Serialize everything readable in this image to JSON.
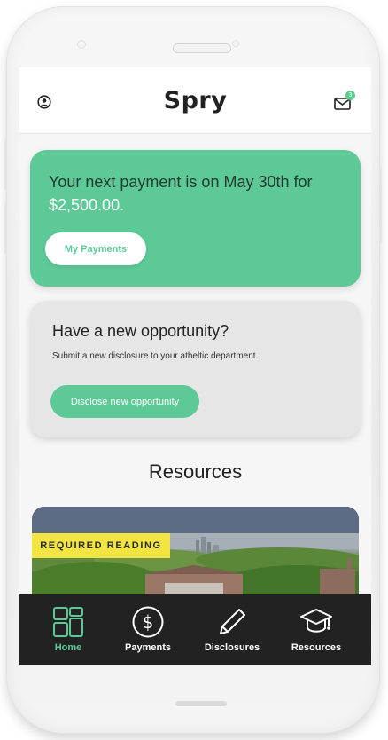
{
  "app": {
    "logo": "Spry",
    "mail_badge": "3"
  },
  "payment_card": {
    "text_prefix": "Your next payment is on May 30th for ",
    "amount": "$2,500.00.",
    "button_label": "My Payments"
  },
  "opportunity_card": {
    "title": "Have a new opportunity?",
    "subtitle": "Submit a new disclosure to your atheltic department.",
    "button_label": "Disclose new opportunity"
  },
  "resources": {
    "title": "Resources",
    "card_badge": "REQUIRED READING"
  },
  "bottom_nav": {
    "items": [
      {
        "label": "Home",
        "icon": "home-grid-icon",
        "active": true
      },
      {
        "label": "Payments",
        "icon": "dollar-circle-icon",
        "active": false
      },
      {
        "label": "Disclosures",
        "icon": "pencil-icon",
        "active": false
      },
      {
        "label": "Resources",
        "icon": "graduation-cap-icon",
        "active": false
      }
    ]
  },
  "colors": {
    "accent_green": "#5dc997",
    "badge_yellow": "#f2e543",
    "nav_background": "#222222",
    "card_gray": "#e6e6e6"
  }
}
